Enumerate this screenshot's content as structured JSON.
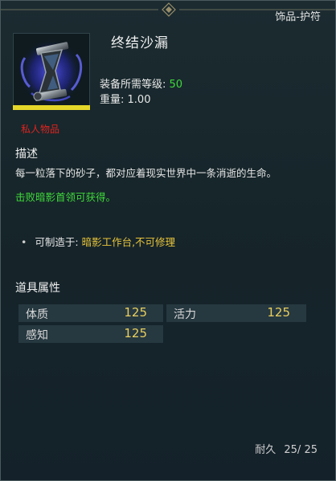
{
  "tooltip": {
    "category": "饰品-护符",
    "item_name": "终结沙漏",
    "level_label": "装备所需等级:",
    "level_value": "50",
    "weight_label": "重量:",
    "weight_value": "1.00",
    "private_tag": "私人物品",
    "rarity_color": "#e5d62a",
    "icon": "hourglass-icon"
  },
  "description": {
    "title": "描述",
    "text": "每一粒落下的砂子，都对应着现实世界中一条消逝的生命。",
    "obtain": "击败暗影首领可获得。"
  },
  "crafting": {
    "label": "可制造于:",
    "value": "暗影工作台,不可修理"
  },
  "attributes": {
    "title": "道具属性",
    "items": [
      {
        "name": "体质",
        "value": "125"
      },
      {
        "name": "活力",
        "value": "125"
      },
      {
        "name": "感知",
        "value": "125"
      }
    ]
  },
  "durability": {
    "label": "耐久",
    "value": "25/ 25"
  }
}
